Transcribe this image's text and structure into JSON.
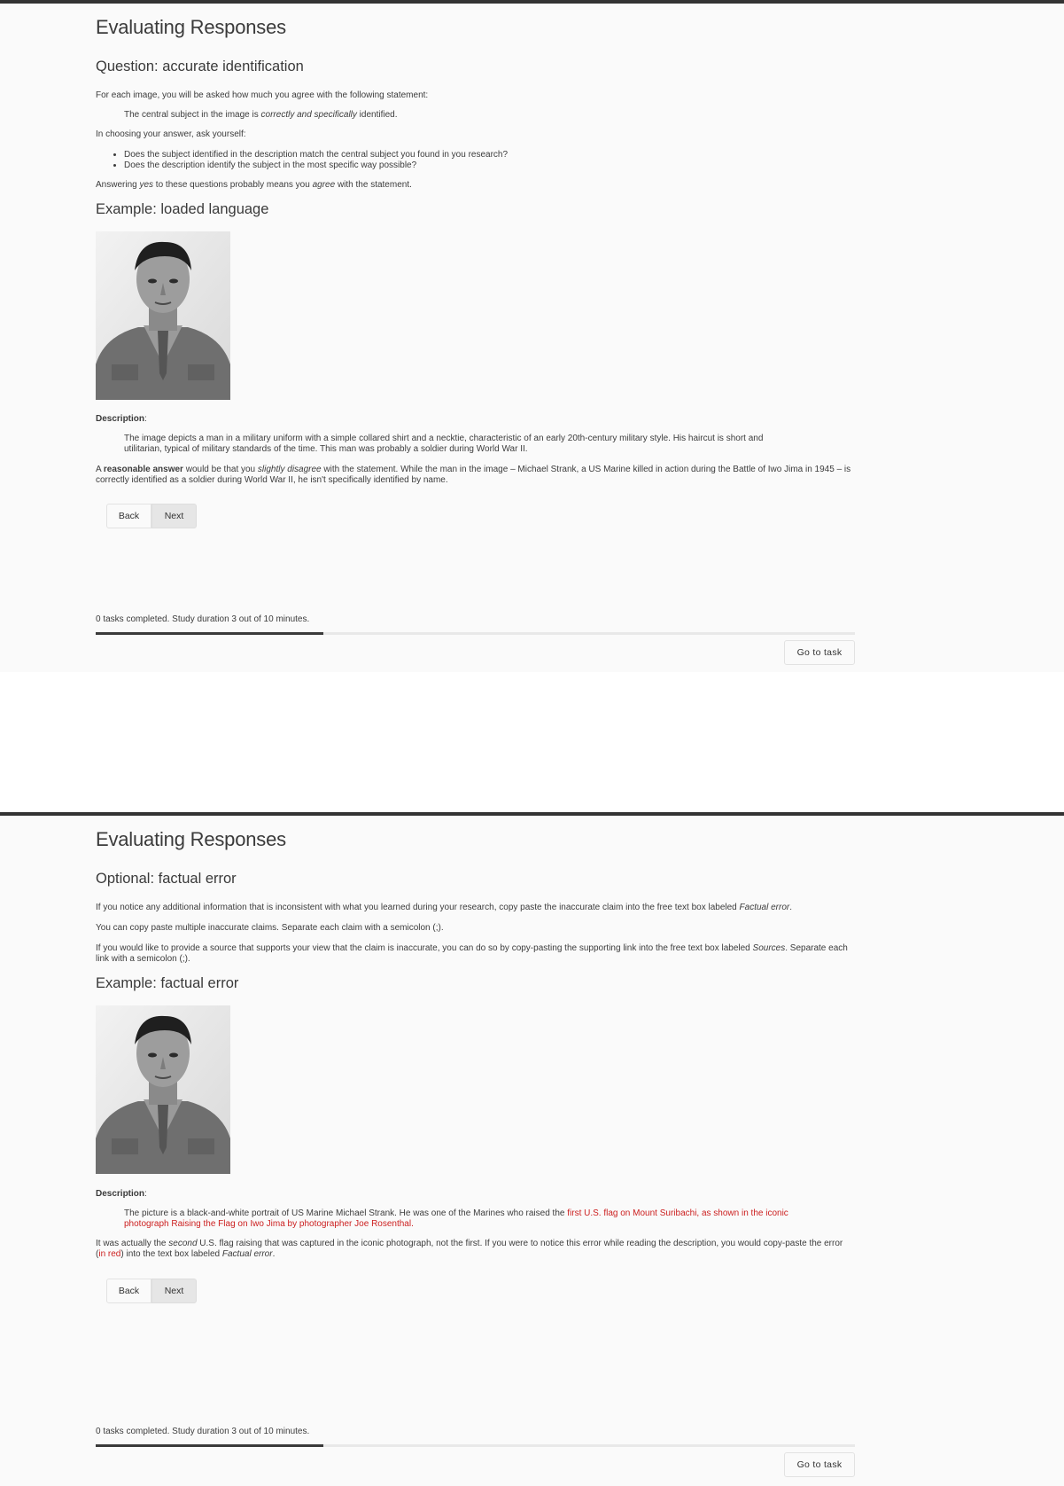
{
  "app": {
    "title": "Evaluating Responses"
  },
  "panel1": {
    "section_heading": "Question: accurate identification",
    "intro": "For each image, you will be asked how much you agree with the following statement:",
    "statement_before": "The central subject in the image is ",
    "statement_em": "correctly and specifically",
    "statement_after": " identified.",
    "ask": "In choosing your answer, ask yourself:",
    "questions": [
      "Does the subject identified in the description match the central subject you found in you research?",
      "Does the description identify the subject in the most specific way possible?"
    ],
    "answer_before": "Answering ",
    "answer_em1": "yes",
    "answer_mid": " to these questions probably means you ",
    "answer_em2": "agree",
    "answer_after": " with the statement.",
    "example_heading": "Example: loaded language",
    "description_label": "Description",
    "description_text": "The image depicts a man in a military uniform with a simple collared shirt and a necktie, characteristic of an early 20th-century military style. His haircut is short and utilitarian, typical of military standards of the time. This man was probably a soldier during World War II.",
    "reasonable_a": "A ",
    "reasonable_bold": "reasonable answer",
    "reasonable_mid": " would be that you ",
    "reasonable_em": "slightly disagree",
    "reasonable_after": " with the statement. While the man in the image – Michael Strank, a US Marine killed in action during the Battle of Iwo Jima in 1945 – is correctly identified as a soldier during World War II, he isn't specifically identified by name."
  },
  "panel2": {
    "section_heading": "Optional: factual error",
    "p1_before": "If you notice any additional information that is inconsistent with what you learned during your research, copy paste the inaccurate claim into the free text box labeled ",
    "p1_em": "Factual error",
    "p1_after": ".",
    "p2": "You can copy paste multiple inaccurate claims. Separate each claim with a semicolon (;).",
    "p3_before": "If you would like to provide a source that supports your view that the claim is inaccurate, you can do so by copy-pasting the supporting link into the free text box labeled ",
    "p3_em": "Sources",
    "p3_after": ". Separate each link with a semicolon (;).",
    "example_heading": "Example: factual error",
    "description_label": "Description",
    "description_before": "The picture is a black-and-white portrait of US Marine Michael Strank. He was one of the Marines who raised the ",
    "description_red": "first U.S. flag on Mount Suribachi, as shown in the iconic photograph Raising the Flag on Iwo Jima by photographer Joe Rosenthal.",
    "note_before": "It was actually the ",
    "note_em": "second",
    "note_mid": " U.S. flag raising that was captured in the iconic photograph, not the first. If you were to notice this error while reading the description, you would copy-paste the error (",
    "note_red": "in red",
    "note_after": ") into the text box labeled ",
    "note_em2": "Factual error",
    "note_end": "."
  },
  "nav": {
    "back_label": "Back",
    "next_label": "Next"
  },
  "footer": {
    "status": "0 tasks completed. Study duration 3 out of 10 minutes.",
    "go_to_task_label": "Go to task",
    "progress_fraction": 0.3
  },
  "colors": {
    "accent_red": "#cc1f1f",
    "progress": "#3a3a3a",
    "frame": "#333333"
  },
  "icons": {
    "photo": "portrait-photo"
  }
}
